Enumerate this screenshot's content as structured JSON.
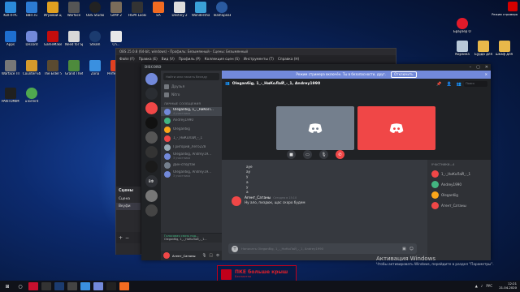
{
  "desktop": {
    "icons_row1": [
      "KDFX-PC",
      "ВВП.ru",
      "Игровой центр",
      "Warface",
      "OBS Studio",
      "GIMP 2",
      "HSPA Looker v1.06 by Jo...",
      "EA",
      "Destiny 2",
      "Wondershare Video Edition",
      "TeamSpeak 3 Client"
    ],
    "icons_row2": [
      "Apps",
      "Discord",
      "GameMaker",
      "Need for Speed",
      "Steam",
      "Ch...",
      "Uplay",
      "Origin",
      "Sea of Thieves",
      "Fortnite",
      "MSI Afterburner"
    ],
    "icons_row3": [
      "Warface ПТС",
      "Counter-Strike Global Offe...",
      "The Elder Scrolls Online",
      "Grand Theft Auto V",
      "Zona",
      "PerfectTUNN...",
      "PUBG LITE"
    ],
    "icons_row4": [
      "PANTOMIMY GAMING H...",
      "uTorrent"
    ],
    "right_icons": [
      "Браузер Opera",
      "Корзина",
      "Бурда для Хода...",
      "шкаф для Хода..."
    ]
  },
  "obs": {
    "title": "OBS 25.0.8 (64-bit, windows) - Профиль: Безымянный - Сцены: Безымянный",
    "menu": [
      "Файл (F)",
      "Правка (E)",
      "Вид (V)",
      "Профиль (P)",
      "Коллекция сцен (S)",
      "Инструменты (T)",
      "Справка (H)"
    ],
    "scenes_header": "Сцены",
    "scene_items": [
      "Сцена",
      "Вкуфи"
    ]
  },
  "discord": {
    "app_name": "DISCORD",
    "notice": {
      "text": "Режим стримера включён. Ты в безопасности, друг.",
      "button": "Отключить"
    },
    "search_placeholder": "Найти или начать беседу",
    "nav": [
      {
        "label": "Друзья"
      },
      {
        "label": "Nitro"
      }
    ],
    "dm_header": "ЛИЧНЫЕ СООБЩЕНИЯ",
    "dms": [
      {
        "name": "Oleganбig, 1_-_НиКоЛ...",
        "sub": "4 участника",
        "color": "#7289da",
        "active": true
      },
      {
        "name": "Andrey1990",
        "sub": "",
        "color": "#43b581"
      },
      {
        "name": "Oleganбig",
        "sub": "",
        "color": "#faa61a"
      },
      {
        "name": "1_-_НиКоЛаЙ_-_1",
        "sub": "",
        "color": "#f04747"
      },
      {
        "name": "Григорий_Лего228",
        "sub": "",
        "color": "#99aab5"
      },
      {
        "name": "Oleganбig, Andrey19...",
        "sub": "3 участника",
        "color": "#7289da"
      },
      {
        "name": "Дин-спортак",
        "sub": "",
        "color": "#747f8d"
      },
      {
        "name": "Oleganбig, Andrey19...",
        "sub": "3 участника",
        "color": "#7289da"
      }
    ],
    "voice": {
      "status": "Голосовая связь под...",
      "channel": "Oleganбig, 1_-_НиКоЛаЙ_-_1..."
    },
    "user": {
      "name": "Агент_Сатаны",
      "tag": "#0000"
    },
    "servers": [
      "",
      "",
      "",
      "",
      "",
      "",
      "",
      "ВФ",
      "",
      ""
    ],
    "call_title": "Oleganбig, 1_-_НиКоЛаЙ_-_1, Andrey1990",
    "header_search": "Поиск",
    "tile_colors": [
      "#747f8d",
      "#f04747"
    ],
    "messages": [
      "ауе",
      "ау",
      "у",
      "а",
      "у",
      "а"
    ],
    "last_message": {
      "author": "Агент_Сатаны",
      "timestamp": "Сегодня в 15:10",
      "text": "Ну ало, пиздюк, щас скоро будем"
    },
    "composer_placeholder": "Написать Oleganбig, 1_-_НиКоЛаЙ_-_1, Andrey1990",
    "members_header": "УЧАСТНИКИ—4",
    "members": [
      {
        "name": "1_-_НиКоЛаЙ_-_1",
        "color": "#f04747"
      },
      {
        "name": "Andrey1990",
        "color": "#43b581"
      },
      {
        "name": "Oleganбig",
        "color": "#faa61a"
      },
      {
        "name": "Агент_Сатаны",
        "color": "#f04747"
      }
    ],
    "stream_badge": "Режим стримера"
  },
  "activation": {
    "title": "Активация Windows",
    "text": "Чтобы активировать Windows, перейдите в раздел \"Параметры\"."
  },
  "promo": {
    "title": "ПКЕ больше крыш",
    "subtitle": "Бесплатно"
  },
  "taskbar": {
    "time": "12:21",
    "date": "21.04.2020",
    "lang": "РУС"
  }
}
